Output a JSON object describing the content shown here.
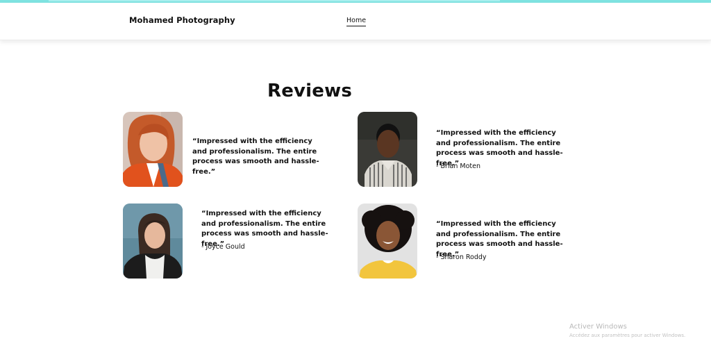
{
  "header": {
    "brand": "Mohamed Photography",
    "nav": [
      {
        "label": "Home"
      }
    ]
  },
  "section": {
    "title": "Reviews"
  },
  "reviews": [
    {
      "quote": "“Impressed with the efficiency and professionalism. The entire process was smooth and hassle-free.”",
      "author": ""
    },
    {
      "quote": "“Impressed with the efficiency and professionalism. The entire process was smooth and hassle-free.”",
      "author": "- Brian Moten"
    },
    {
      "quote": "“Impressed with the efficiency and professionalism. The entire process was smooth and hassle-free.”",
      "author": "- Joyce Gould"
    },
    {
      "quote": "“Impressed with the efficiency and professionalism. The entire process was smooth and hassle-free.”",
      "author": "- Sharon Roddy"
    }
  ],
  "watermark": {
    "title": "Activer Windows",
    "subtitle": "Accédez aux paramètres pour activer Windows."
  },
  "colors": {
    "accent_bar": "#7fe3e1",
    "text": "#111111",
    "background": "#ffffff"
  }
}
